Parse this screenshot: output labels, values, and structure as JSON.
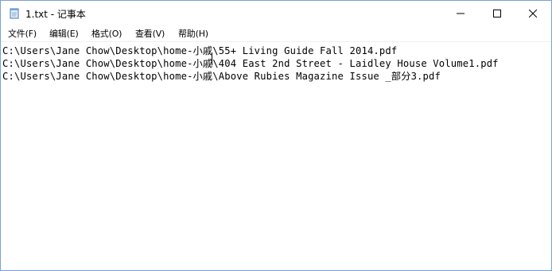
{
  "window": {
    "title": "1.txt - 记事本"
  },
  "titlebar": {
    "icons": {
      "app": "notepad-icon",
      "minimize": "minimize-icon",
      "maximize": "maximize-icon",
      "close": "close-icon"
    }
  },
  "menu": {
    "file": "文件(F)",
    "edit": "编辑(E)",
    "format": "格式(O)",
    "view": "查看(V)",
    "help": "帮助(H)"
  },
  "editor": {
    "lines": [
      "C:\\Users\\Jane Chow\\Desktop\\home-小戚\\55+ Living Guide Fall 2014.pdf",
      "C:\\Users\\Jane Chow\\Desktop\\home-小戚\\404 East 2nd Street - Laidley House Volume1.pdf",
      "C:\\Users\\Jane Chow\\Desktop\\home-小戚\\Above Rubies Magazine Issue _部分3.pdf"
    ]
  },
  "colors": {
    "window_border": "#7a9fd4",
    "background": "#ffffff",
    "text": "#000000"
  }
}
